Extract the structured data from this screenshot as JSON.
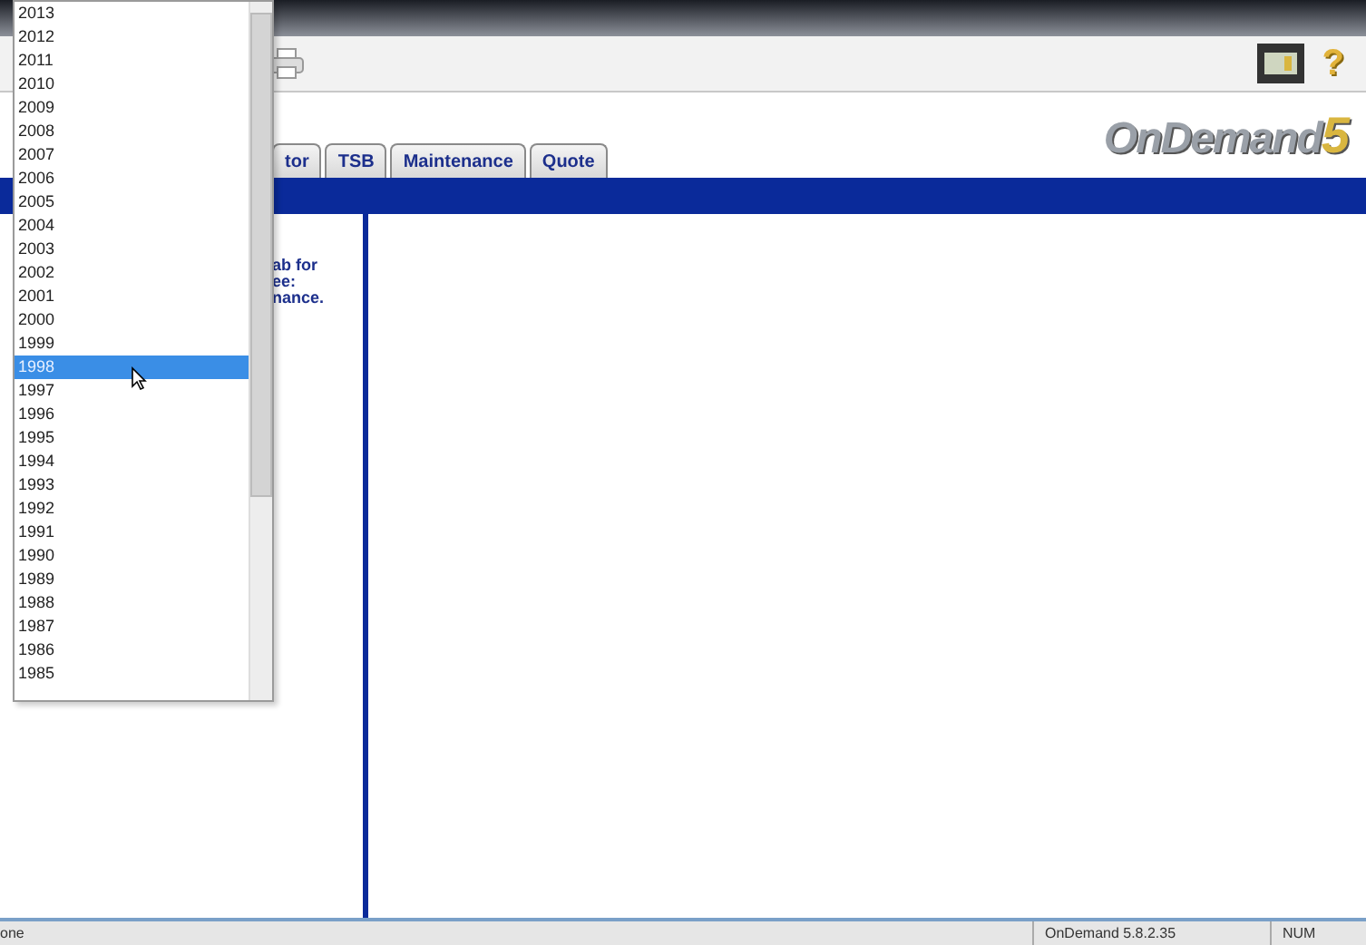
{
  "toolbar": {
    "help_glyph": "?"
  },
  "header": {
    "logo": {
      "text": "OnDemand",
      "number": "5"
    },
    "tabs": [
      {
        "label": "tor",
        "selected": false
      },
      {
        "label": "TSB",
        "selected": false
      },
      {
        "label": "Maintenance",
        "selected": false
      },
      {
        "label": "Quote",
        "selected": false
      }
    ]
  },
  "left_panel": {
    "lines": [
      "ab for",
      "ee:",
      "nance."
    ]
  },
  "year_list": [
    {
      "label": "2013",
      "selected": false
    },
    {
      "label": "2012",
      "selected": false
    },
    {
      "label": "2011",
      "selected": false
    },
    {
      "label": "2010",
      "selected": false
    },
    {
      "label": "2009",
      "selected": false
    },
    {
      "label": "2008",
      "selected": false
    },
    {
      "label": "2007",
      "selected": false
    },
    {
      "label": "2006",
      "selected": false
    },
    {
      "label": "2005",
      "selected": false
    },
    {
      "label": "2004",
      "selected": false
    },
    {
      "label": "2003",
      "selected": false
    },
    {
      "label": "2002",
      "selected": false
    },
    {
      "label": "2001",
      "selected": false
    },
    {
      "label": "2000",
      "selected": false
    },
    {
      "label": "1999",
      "selected": false
    },
    {
      "label": "1998",
      "selected": true
    },
    {
      "label": "1997",
      "selected": false
    },
    {
      "label": "1996",
      "selected": false
    },
    {
      "label": "1995",
      "selected": false
    },
    {
      "label": "1994",
      "selected": false
    },
    {
      "label": "1993",
      "selected": false
    },
    {
      "label": "1992",
      "selected": false
    },
    {
      "label": "1991",
      "selected": false
    },
    {
      "label": "1990",
      "selected": false
    },
    {
      "label": "1989",
      "selected": false
    },
    {
      "label": "1988",
      "selected": false
    },
    {
      "label": "1987",
      "selected": false
    },
    {
      "label": "1986",
      "selected": false
    },
    {
      "label": "1985",
      "selected": false
    }
  ],
  "status_bar": {
    "message": "one",
    "version": "OnDemand 5.8.2.35",
    "indicator": "NUM"
  }
}
